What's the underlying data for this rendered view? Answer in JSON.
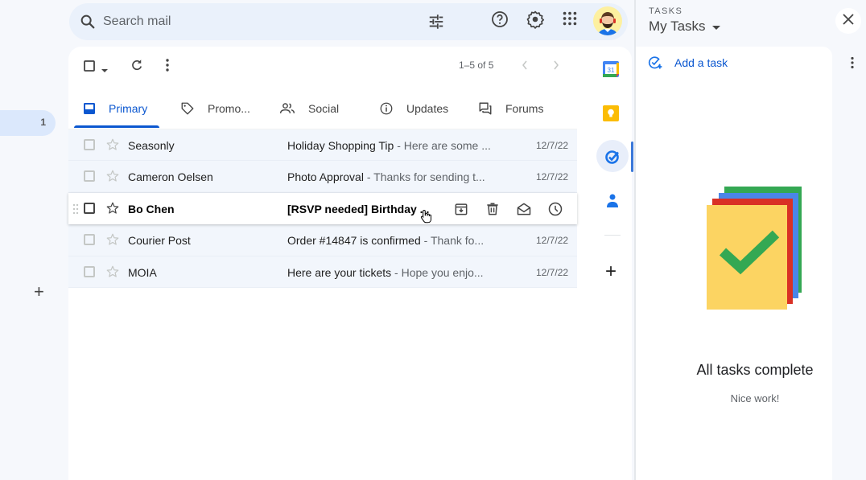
{
  "sidebar": {
    "badge_count": "1",
    "create_label_icon": "plus-icon"
  },
  "search": {
    "placeholder": "Search mail",
    "value": ""
  },
  "header": {
    "icons": [
      "search-icon",
      "tune-icon",
      "help-icon",
      "settings-icon",
      "apps-icon",
      "avatar"
    ]
  },
  "toolbar": {
    "pager_text": "1–5 of 5"
  },
  "tabs": [
    {
      "label": "Primary",
      "icon": "inbox-icon",
      "active": true
    },
    {
      "label": "Promo...",
      "icon": "tag-icon",
      "active": false
    },
    {
      "label": "Social",
      "icon": "people-icon",
      "active": false
    },
    {
      "label": "Updates",
      "icon": "info-icon",
      "active": false
    },
    {
      "label": "Forums",
      "icon": "forum-icon",
      "active": false
    }
  ],
  "emails": [
    {
      "sender": "Seasonly",
      "subject": "Holiday Shopping Tip",
      "snippet": " - Here are some ...",
      "date": "12/7/22",
      "unread": false
    },
    {
      "sender": "Cameron Oelsen",
      "subject": "Photo Approval",
      "snippet": " - Thanks for sending t...",
      "date": "12/7/22",
      "unread": false
    },
    {
      "sender": "Bo Chen",
      "subject": "[RSVP needed] Birthday ...",
      "snippet": "",
      "date": "",
      "unread": true,
      "hovered": true
    },
    {
      "sender": "Courier Post",
      "subject": "Order #14847 is confirmed",
      "snippet": " - Thank fo...",
      "date": "12/7/22",
      "unread": false
    },
    {
      "sender": "MOIA",
      "subject": "Here are your tickets",
      "snippet": " - Hope you enjo...",
      "date": "12/7/22",
      "unread": false
    }
  ],
  "row_actions": [
    "archive-icon",
    "delete-icon",
    "mark-read-icon",
    "snooze-icon"
  ],
  "rail": {
    "calendar_day": "31",
    "items": [
      "calendar-icon",
      "keep-icon",
      "tasks-icon",
      "contacts-icon",
      "add-app-icon"
    ]
  },
  "tasks": {
    "label": "TASKS",
    "list_name": "My Tasks",
    "add_task": "Add a task",
    "empty_title": "All tasks complete",
    "empty_sub": "Nice work!",
    "illustration_colors": [
      "#34a853",
      "#4a86e8",
      "#d93025",
      "#fcd462"
    ]
  },
  "colors": {
    "accent": "#0b57d0",
    "background": "#f6f8fc"
  }
}
